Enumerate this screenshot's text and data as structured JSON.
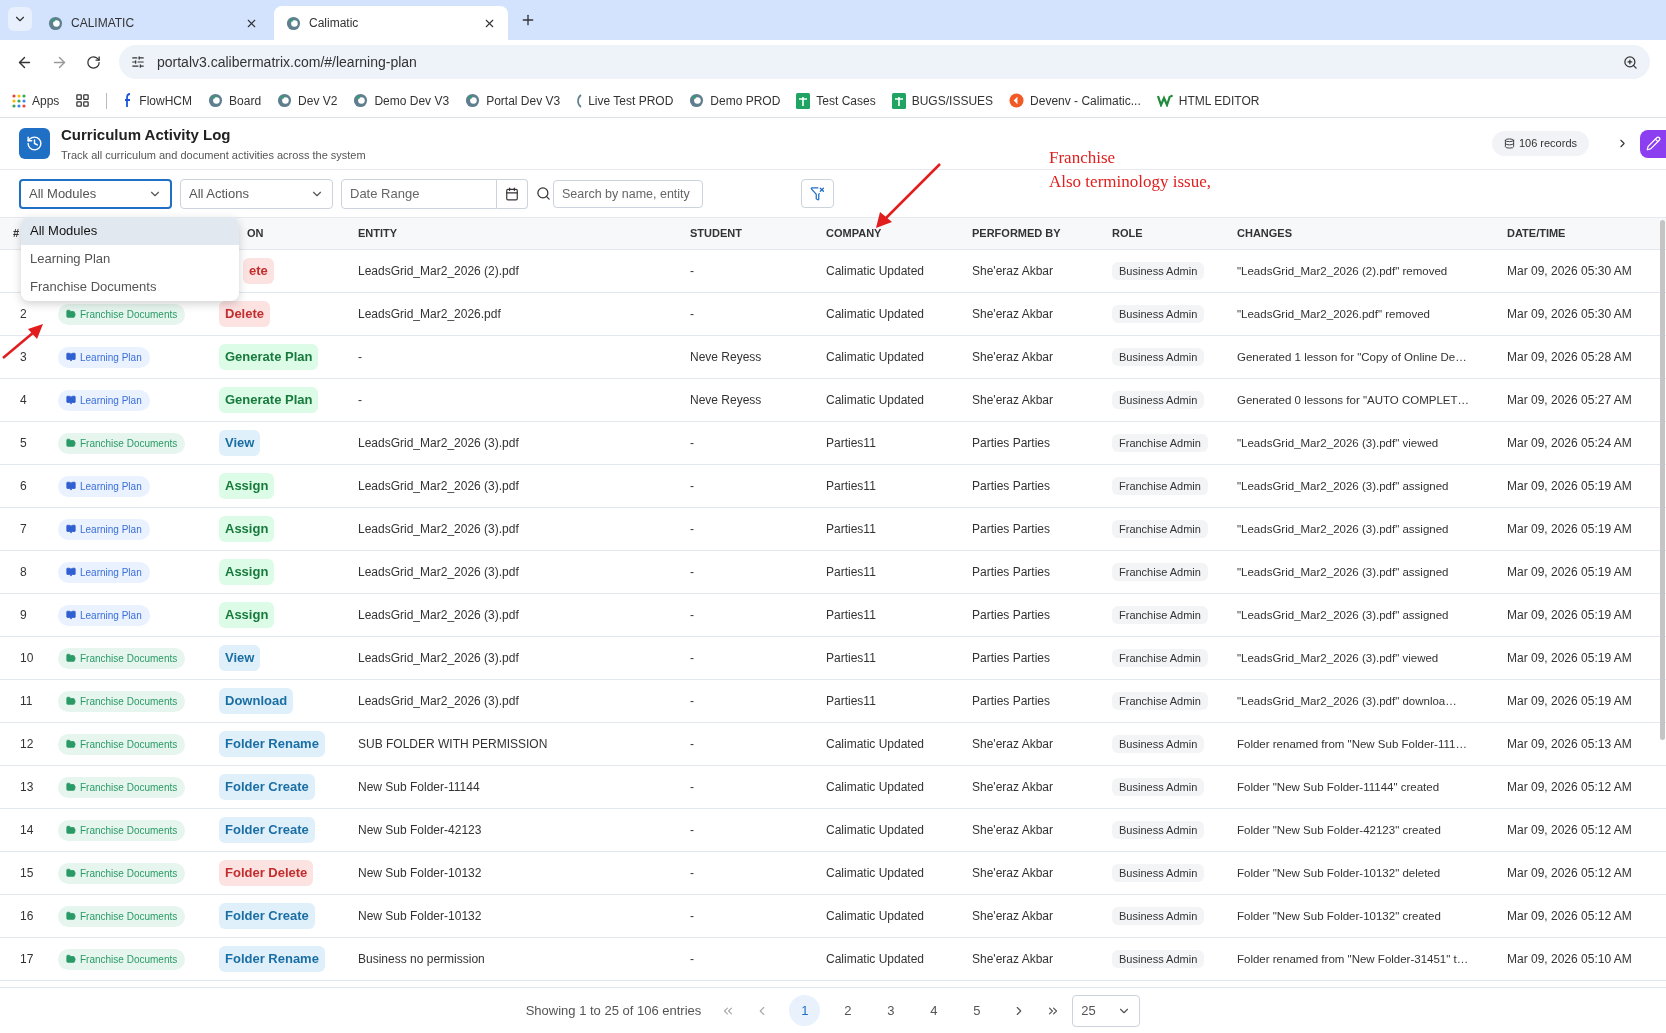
{
  "browser": {
    "tabs": [
      {
        "title": "CALIMATIC",
        "selected": false
      },
      {
        "title": "Calimatic",
        "selected": true
      }
    ],
    "url": "portalv3.calibermatrix.com/#/learning-plan",
    "bookmarks": [
      {
        "label": "Apps",
        "kind": "apps"
      },
      {
        "label": "FlowHCM",
        "kind": "letter"
      },
      {
        "label": "Board",
        "kind": "logo"
      },
      {
        "label": "Dev V2",
        "kind": "logo"
      },
      {
        "label": "Demo Dev V3",
        "kind": "logo"
      },
      {
        "label": "Portal Dev V3",
        "kind": "logo"
      },
      {
        "label": "Live Test PROD",
        "kind": "partial"
      },
      {
        "label": "Demo PROD",
        "kind": "logo"
      },
      {
        "label": "Test Cases",
        "kind": "sheet"
      },
      {
        "label": "BUGS/ISSUES",
        "kind": "sheet"
      },
      {
        "label": "Devenv - Calimatic...",
        "kind": "orange"
      },
      {
        "label": "HTML EDITOR",
        "kind": "w"
      }
    ]
  },
  "page": {
    "title": "Curriculum Activity Log",
    "subtitle": "Track all curriculum and document activities across the system",
    "records": "106 records"
  },
  "filters": {
    "module": "All Modules",
    "action": "All Actions",
    "date_placeholder": "Date Range",
    "search_placeholder": "Search by name, entity"
  },
  "module_menu": [
    {
      "label": "All Modules",
      "selected": true
    },
    {
      "label": "Learning Plan",
      "selected": false
    },
    {
      "label": "Franchise Documents",
      "selected": false
    }
  ],
  "columns": [
    "#",
    "ON",
    "ENTITY",
    "STUDENT",
    "COMPANY",
    "PERFORMED BY",
    "ROLE",
    "CHANGES",
    "DATE/TIME"
  ],
  "rows": [
    {
      "action": {
        "label": "ete",
        "kind": "danger"
      },
      "entity": "LeadsGrid_Mar2_2026 (2).pdf",
      "student": "-",
      "company": "Calimatic Updated",
      "performed_by": "She'eraz Akbar",
      "role": "Business Admin",
      "changes": "\"LeadsGrid_Mar2_2026 (2).pdf\" removed",
      "datetime": "Mar 09, 2026 05:30 AM"
    },
    {
      "n": "2",
      "module": {
        "label": "Franchise Documents",
        "kind": "franchise"
      },
      "action": {
        "label": "Delete",
        "kind": "danger"
      },
      "entity": "LeadsGrid_Mar2_2026.pdf",
      "student": "-",
      "company": "Calimatic Updated",
      "performed_by": "She'eraz Akbar",
      "role": "Business Admin",
      "changes": "\"LeadsGrid_Mar2_2026.pdf\" removed",
      "datetime": "Mar 09, 2026 05:30 AM"
    },
    {
      "n": "3",
      "module": {
        "label": "Learning Plan",
        "kind": "learning"
      },
      "action": {
        "label": "Generate Plan",
        "kind": "success"
      },
      "entity": "-",
      "student": "Neve Reyess",
      "company": "Calimatic Updated",
      "performed_by": "She'eraz Akbar",
      "role": "Business Admin",
      "changes": "Generated 1 lesson for \"Copy of Online De…",
      "datetime": "Mar 09, 2026 05:28 AM"
    },
    {
      "n": "4",
      "module": {
        "label": "Learning Plan",
        "kind": "learning"
      },
      "action": {
        "label": "Generate Plan",
        "kind": "success"
      },
      "entity": "-",
      "student": "Neve Reyess",
      "company": "Calimatic Updated",
      "performed_by": "She'eraz Akbar",
      "role": "Business Admin",
      "changes": "Generated 0 lessons for \"AUTO COMPLET…",
      "datetime": "Mar 09, 2026 05:27 AM"
    },
    {
      "n": "5",
      "module": {
        "label": "Franchise Documents",
        "kind": "franchise"
      },
      "action": {
        "label": "View",
        "kind": "info"
      },
      "entity": "LeadsGrid_Mar2_2026 (3).pdf",
      "student": "-",
      "company": "Parties11",
      "performed_by": "Parties Parties",
      "role": "Franchise Admin",
      "changes": "\"LeadsGrid_Mar2_2026 (3).pdf\" viewed",
      "datetime": "Mar 09, 2026 05:24 AM"
    },
    {
      "n": "6",
      "module": {
        "label": "Learning Plan",
        "kind": "learning"
      },
      "action": {
        "label": "Assign",
        "kind": "success"
      },
      "entity": "LeadsGrid_Mar2_2026 (3).pdf",
      "student": "-",
      "company": "Parties11",
      "performed_by": "Parties Parties",
      "role": "Franchise Admin",
      "changes": "\"LeadsGrid_Mar2_2026 (3).pdf\" assigned",
      "datetime": "Mar 09, 2026 05:19 AM"
    },
    {
      "n": "7",
      "module": {
        "label": "Learning Plan",
        "kind": "learning"
      },
      "action": {
        "label": "Assign",
        "kind": "success"
      },
      "entity": "LeadsGrid_Mar2_2026 (3).pdf",
      "student": "-",
      "company": "Parties11",
      "performed_by": "Parties Parties",
      "role": "Franchise Admin",
      "changes": "\"LeadsGrid_Mar2_2026 (3).pdf\" assigned",
      "datetime": "Mar 09, 2026 05:19 AM"
    },
    {
      "n": "8",
      "module": {
        "label": "Learning Plan",
        "kind": "learning"
      },
      "action": {
        "label": "Assign",
        "kind": "success"
      },
      "entity": "LeadsGrid_Mar2_2026 (3).pdf",
      "student": "-",
      "company": "Parties11",
      "performed_by": "Parties Parties",
      "role": "Franchise Admin",
      "changes": "\"LeadsGrid_Mar2_2026 (3).pdf\" assigned",
      "datetime": "Mar 09, 2026 05:19 AM"
    },
    {
      "n": "9",
      "module": {
        "label": "Learning Plan",
        "kind": "learning"
      },
      "action": {
        "label": "Assign",
        "kind": "success"
      },
      "entity": "LeadsGrid_Mar2_2026 (3).pdf",
      "student": "-",
      "company": "Parties11",
      "performed_by": "Parties Parties",
      "role": "Franchise Admin",
      "changes": "\"LeadsGrid_Mar2_2026 (3).pdf\" assigned",
      "datetime": "Mar 09, 2026 05:19 AM"
    },
    {
      "n": "10",
      "module": {
        "label": "Franchise Documents",
        "kind": "franchise"
      },
      "action": {
        "label": "View",
        "kind": "info"
      },
      "entity": "LeadsGrid_Mar2_2026 (3).pdf",
      "student": "-",
      "company": "Parties11",
      "performed_by": "Parties Parties",
      "role": "Franchise Admin",
      "changes": "\"LeadsGrid_Mar2_2026 (3).pdf\" viewed",
      "datetime": "Mar 09, 2026 05:19 AM"
    },
    {
      "n": "11",
      "module": {
        "label": "Franchise Documents",
        "kind": "franchise"
      },
      "action": {
        "label": "Download",
        "kind": "info"
      },
      "entity": "LeadsGrid_Mar2_2026 (3).pdf",
      "student": "-",
      "company": "Parties11",
      "performed_by": "Parties Parties",
      "role": "Franchise Admin",
      "changes": "\"LeadsGrid_Mar2_2026 (3).pdf\" downloa…",
      "datetime": "Mar 09, 2026 05:19 AM"
    },
    {
      "n": "12",
      "module": {
        "label": "Franchise Documents",
        "kind": "franchise"
      },
      "action": {
        "label": "Folder Rename",
        "kind": "info"
      },
      "entity": "SUB FOLDER WITH PERMISSION",
      "student": "-",
      "company": "Calimatic Updated",
      "performed_by": "She'eraz Akbar",
      "role": "Business Admin",
      "changes": "Folder renamed from \"New Sub Folder-111…",
      "datetime": "Mar 09, 2026 05:13 AM"
    },
    {
      "n": "13",
      "module": {
        "label": "Franchise Documents",
        "kind": "franchise"
      },
      "action": {
        "label": "Folder Create",
        "kind": "info"
      },
      "entity": "New Sub Folder-11144",
      "student": "-",
      "company": "Calimatic Updated",
      "performed_by": "She'eraz Akbar",
      "role": "Business Admin",
      "changes": "Folder \"New Sub Folder-11144\" created",
      "datetime": "Mar 09, 2026 05:12 AM"
    },
    {
      "n": "14",
      "module": {
        "label": "Franchise Documents",
        "kind": "franchise"
      },
      "action": {
        "label": "Folder Create",
        "kind": "info"
      },
      "entity": "New Sub Folder-42123",
      "student": "-",
      "company": "Calimatic Updated",
      "performed_by": "She'eraz Akbar",
      "role": "Business Admin",
      "changes": "Folder \"New Sub Folder-42123\" created",
      "datetime": "Mar 09, 2026 05:12 AM"
    },
    {
      "n": "15",
      "module": {
        "label": "Franchise Documents",
        "kind": "franchise"
      },
      "action": {
        "label": "Folder Delete",
        "kind": "danger"
      },
      "entity": "New Sub Folder-10132",
      "student": "-",
      "company": "Calimatic Updated",
      "performed_by": "She'eraz Akbar",
      "role": "Business Admin",
      "changes": "Folder \"New Sub Folder-10132\" deleted",
      "datetime": "Mar 09, 2026 05:12 AM"
    },
    {
      "n": "16",
      "module": {
        "label": "Franchise Documents",
        "kind": "franchise"
      },
      "action": {
        "label": "Folder Create",
        "kind": "info"
      },
      "entity": "New Sub Folder-10132",
      "student": "-",
      "company": "Calimatic Updated",
      "performed_by": "She'eraz Akbar",
      "role": "Business Admin",
      "changes": "Folder \"New Sub Folder-10132\" created",
      "datetime": "Mar 09, 2026 05:12 AM"
    },
    {
      "n": "17",
      "module": {
        "label": "Franchise Documents",
        "kind": "franchise"
      },
      "action": {
        "label": "Folder Rename",
        "kind": "info"
      },
      "entity": "Business no permission",
      "student": "-",
      "company": "Calimatic Updated",
      "performed_by": "She'eraz Akbar",
      "role": "Business Admin",
      "changes": "Folder renamed from \"New Folder-31451\" t…",
      "datetime": "Mar 09, 2026 05:10 AM"
    }
  ],
  "pagination": {
    "summary": "Showing 1 to 25 of 106 entries",
    "pages": [
      {
        "label": "1",
        "selected": true
      },
      {
        "label": "2",
        "selected": false
      },
      {
        "label": "3",
        "selected": false
      },
      {
        "label": "4",
        "selected": false
      },
      {
        "label": "5",
        "selected": false
      }
    ],
    "page_size": "25"
  },
  "annotation": {
    "lines": [
      "Franchise",
      "Also terminology issue,"
    ]
  }
}
